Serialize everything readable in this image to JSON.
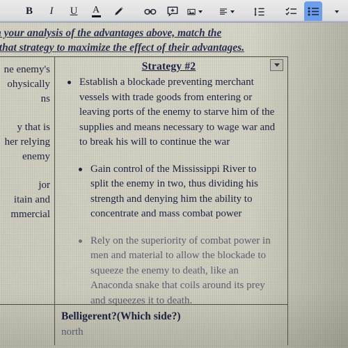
{
  "toolbar": {
    "items": [
      {
        "name": "bold-icon",
        "label": "B",
        "kind": "text-bold",
        "active": false
      },
      {
        "name": "italic-icon",
        "label": "I",
        "kind": "text-italic",
        "active": false
      },
      {
        "name": "underline-icon",
        "label": "U",
        "kind": "text-underline",
        "active": false
      },
      {
        "name": "text-color-icon",
        "label": "A",
        "kind": "text-color",
        "active": false
      },
      {
        "name": "highlight-pen-icon",
        "label": "",
        "kind": "pen",
        "active": false
      },
      {
        "name": "insert-link-icon",
        "label": "",
        "kind": "link",
        "active": false
      },
      {
        "name": "add-comment-icon",
        "label": "",
        "kind": "comment",
        "active": false
      },
      {
        "name": "insert-image-icon",
        "label": "",
        "kind": "image",
        "active": false
      },
      {
        "name": "align-icon",
        "label": "",
        "kind": "align",
        "active": false
      },
      {
        "name": "line-spacing-icon",
        "label": "",
        "kind": "line-spacing",
        "active": false
      },
      {
        "name": "checklist-icon",
        "label": "",
        "kind": "checklist",
        "active": false
      },
      {
        "name": "bulleted-list-icon",
        "label": "",
        "kind": "bullet-list",
        "active": true
      },
      {
        "name": "numbered-list-icon",
        "label": "",
        "kind": "number-list",
        "active": false
      },
      {
        "name": "decrease-indent-icon",
        "label": "",
        "kind": "outdent",
        "active": false
      },
      {
        "name": "increase-indent-icon",
        "label": "",
        "kind": "indent",
        "active": false
      }
    ],
    "accent_color": "#6d9eeb"
  },
  "document": {
    "instructions": {
      "line1": "om your analysis of the advantages above, match the",
      "line2": "se that strategy to maximize the effect of their advantages."
    },
    "table": {
      "left_column_fragments": [
        [
          "ne enemy's",
          "ohysically",
          "ns"
        ],
        [
          "y that is",
          "her relying",
          " enemy"
        ],
        [
          "jor",
          "itain and",
          "mmercial"
        ]
      ],
      "strategy_title": "Strategy #2",
      "bullets": [
        {
          "text": "Establish a blockade preventing merchant vessels with trade goods from entering or leaving ports of the enemy to starve him of the supplies and means necessary to wage war and to break his will to continue the war",
          "indented": false,
          "faded": false
        },
        {
          "text": "Gain control of the Mississippi River to split the enemy in two, thus dividing his strength and denying him the ability to concentrate and mass combat power",
          "indented": true,
          "faded": false
        },
        {
          "text": "Rely on the superiority of combat power in men and material to allow the blockade to squeeze the enemy to death, like an Anaconda snake that coils around its prey and squeezes it to death.",
          "indented": true,
          "faded": true
        }
      ],
      "bottom_row": {
        "question": "Belligerent?(Which side?)",
        "answer": "north"
      }
    }
  }
}
